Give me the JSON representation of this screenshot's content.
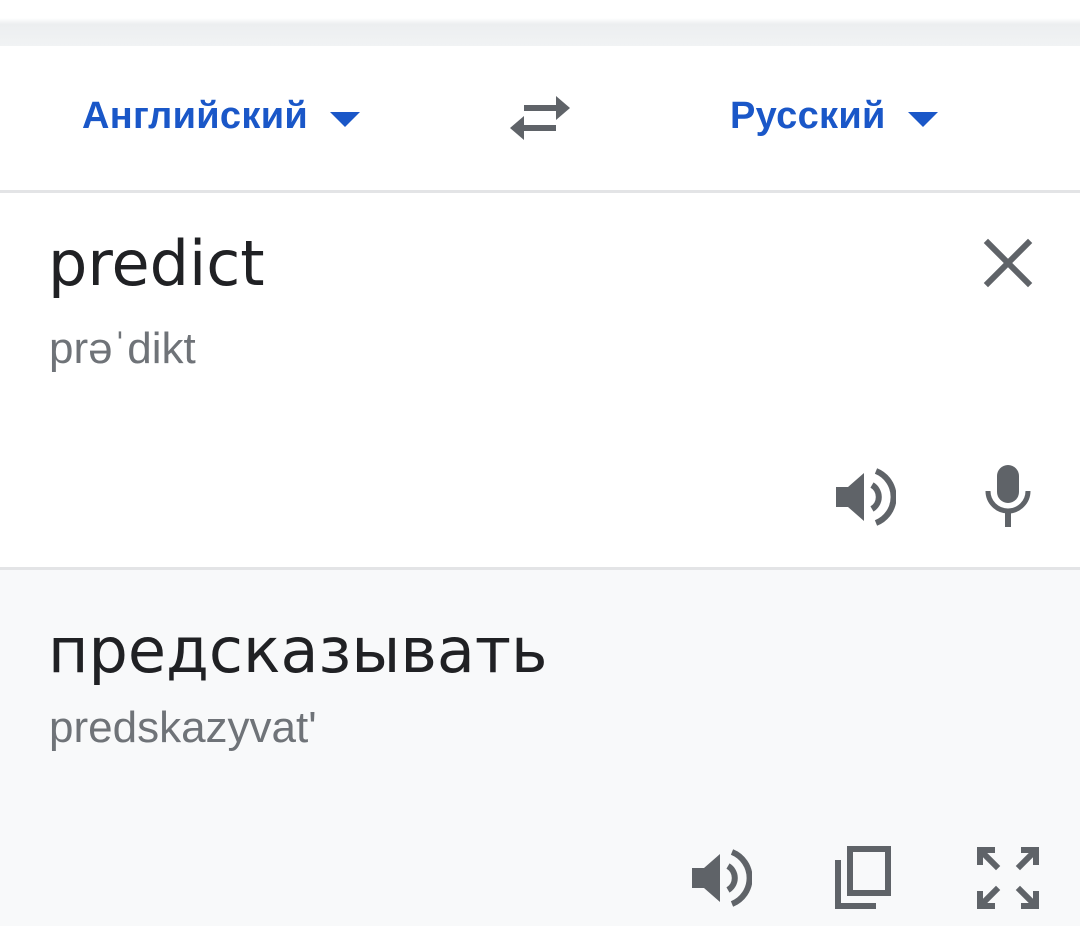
{
  "language_bar": {
    "source_language": "Английский",
    "target_language": "Русский",
    "swap_icon": "swap-arrows-icon",
    "caret_icon": "caret-down-icon"
  },
  "input": {
    "text": "predict",
    "transliteration": "prəˈdikt",
    "icons": [
      "close-icon",
      "speaker-icon",
      "microphone-icon"
    ]
  },
  "output": {
    "text": "предсказывать",
    "transliteration": "predskazyvat'",
    "icons": [
      "speaker-icon",
      "copy-icon",
      "fullscreen-icon"
    ]
  },
  "colors": {
    "accent": "#1a57c8",
    "icon": "#5f6368",
    "output_background": "#f8f9fa",
    "divider": "#e3e4e6"
  }
}
